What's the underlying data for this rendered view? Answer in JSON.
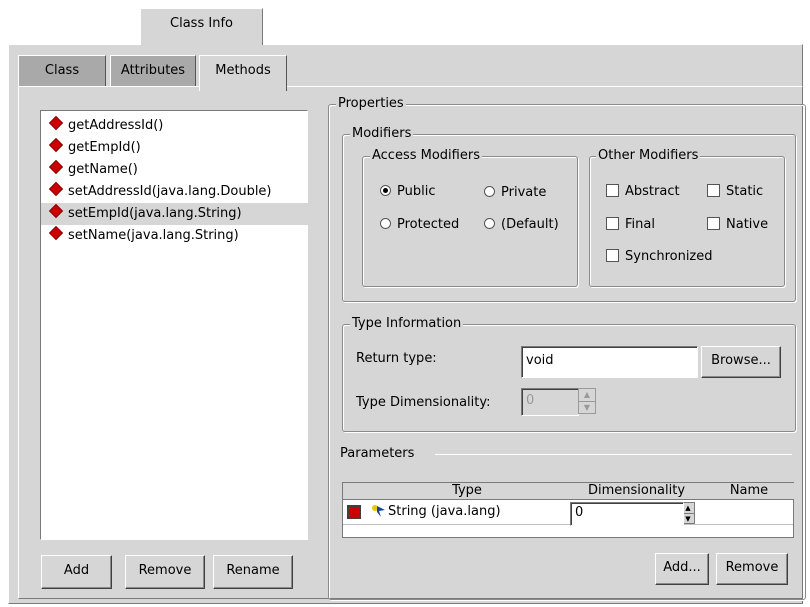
{
  "window": {
    "top_tab": "Class Info"
  },
  "tabs": {
    "class": "Class",
    "attributes": "Attributes",
    "methods": "Methods"
  },
  "methods": [
    "getAddressId()",
    "getEmpId()",
    "getName()",
    "setAddressId(java.lang.Double)",
    "setEmpId(java.lang.String)",
    "setName(java.lang.String)"
  ],
  "selected_method": "setEmpId(java.lang.String)",
  "list_buttons": {
    "add": "Add",
    "remove": "Remove",
    "rename": "Rename"
  },
  "properties": {
    "title": "Properties",
    "modifiers": {
      "title": "Modifiers",
      "access": {
        "title": "Access Modifiers",
        "public": "Public",
        "private": "Private",
        "protected": "Protected",
        "default": "(Default)",
        "selected": "Public"
      },
      "other": {
        "title": "Other Modifiers",
        "abstract": "Abstract",
        "static": "Static",
        "final": "Final",
        "native": "Native",
        "synchronized": "Synchronized"
      }
    },
    "type_info": {
      "title": "Type Information",
      "return_label": "Return type:",
      "return_value": "void",
      "browse": "Browse...",
      "dim_label": "Type Dimensionality:",
      "dim_value": "0"
    },
    "parameters": {
      "title": "Parameters",
      "columns": {
        "type": "Type",
        "dimensionality": "Dimensionality",
        "name": "Name"
      },
      "rows": [
        {
          "type": "String (java.lang)",
          "dimensionality": "0",
          "name": ""
        }
      ],
      "add": "Add...",
      "remove": "Remove"
    }
  },
  "colors": {
    "panel": "#d6d6d6",
    "tab_inactive": "#a9a9a9",
    "method_icon": "#cc0000"
  }
}
